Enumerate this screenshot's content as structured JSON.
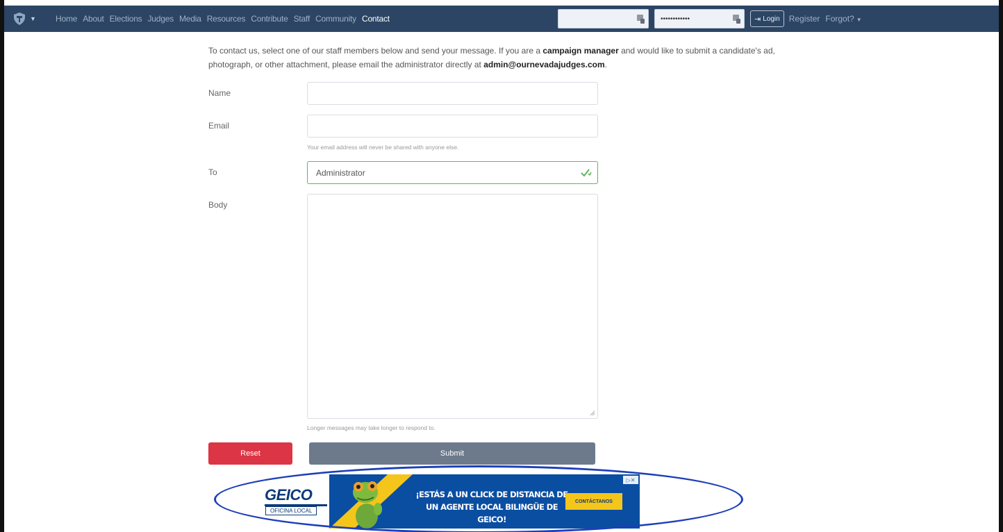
{
  "nav": {
    "items": [
      {
        "label": "Home"
      },
      {
        "label": "About"
      },
      {
        "label": "Elections"
      },
      {
        "label": "Judges"
      },
      {
        "label": "Media"
      },
      {
        "label": "Resources"
      },
      {
        "label": "Contribute"
      },
      {
        "label": "Staff"
      },
      {
        "label": "Community"
      },
      {
        "label": "Contact",
        "active": true
      }
    ],
    "password_value": "••••••••••••",
    "login_label": "Login",
    "register_label": "Register",
    "forgot_label": "Forgot?"
  },
  "intro": {
    "part1": "To contact us, select one of our staff members below and send your message. If you are a ",
    "bold1": "campaign manager",
    "part2": " and would like to submit a candidate's ad, photograph, or other attachment, please email the administrator directly at ",
    "bold2": "admin@ournevadajudges.com",
    "part3": "."
  },
  "form": {
    "name_label": "Name",
    "email_label": "Email",
    "email_help": "Your email address will never be shared with anyone else.",
    "to_label": "To",
    "to_value": "Administrator",
    "body_label": "Body",
    "body_help": "Longer messages may take longer to respond to.",
    "reset_label": "Reset",
    "submit_label": "Submit"
  },
  "ad": {
    "logo": "GEICO",
    "office": "OFICINA LOCAL",
    "headline_line1": "¡ESTÁS A UN CLICK DE DISTANCIA DE",
    "headline_line2": "UN AGENTE LOCAL BILINGÜE DE GEICO!",
    "cta": "CONTÁCTANOS",
    "adchoices": "▷✕"
  },
  "colors": {
    "navbar": "#2c4565",
    "reset": "#dc3545",
    "submit": "#6c7a8c",
    "valid": "#5cb85c",
    "highlight": "#1d3fb8"
  }
}
